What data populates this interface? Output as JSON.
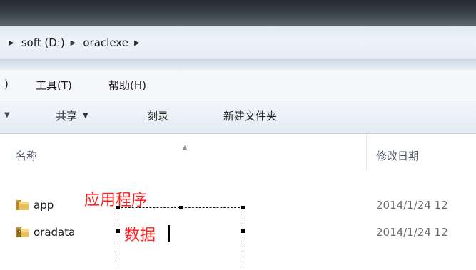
{
  "address_bar": {
    "crumbs": [
      {
        "label": "soft (D:)"
      },
      {
        "label": "oraclexe"
      }
    ],
    "trailing_arrow": "▸"
  },
  "menu": {
    "partial_paren": ")",
    "items": [
      {
        "label": "工具(",
        "accel": "T",
        "suffix": ")"
      },
      {
        "label": "帮助(",
        "accel": "H",
        "suffix": ")"
      }
    ]
  },
  "toolbar": {
    "share_label": "共享",
    "burn_label": "刻录",
    "new_folder_label": "新建文件夹"
  },
  "columns": {
    "name": "名称",
    "modified": "修改日期"
  },
  "files": [
    {
      "name": "app",
      "date": "2014/1/24 12",
      "icon": "folder-icon",
      "locked": false
    },
    {
      "name": "oradata",
      "date": "2014/1/24 12",
      "icon": "locked-folder-icon",
      "locked": true
    }
  ],
  "annotations": {
    "app_note": "应用程序",
    "data_note": "数据"
  },
  "colors": {
    "annotation": "#ff1f1f",
    "folder": "#e8c15a"
  }
}
